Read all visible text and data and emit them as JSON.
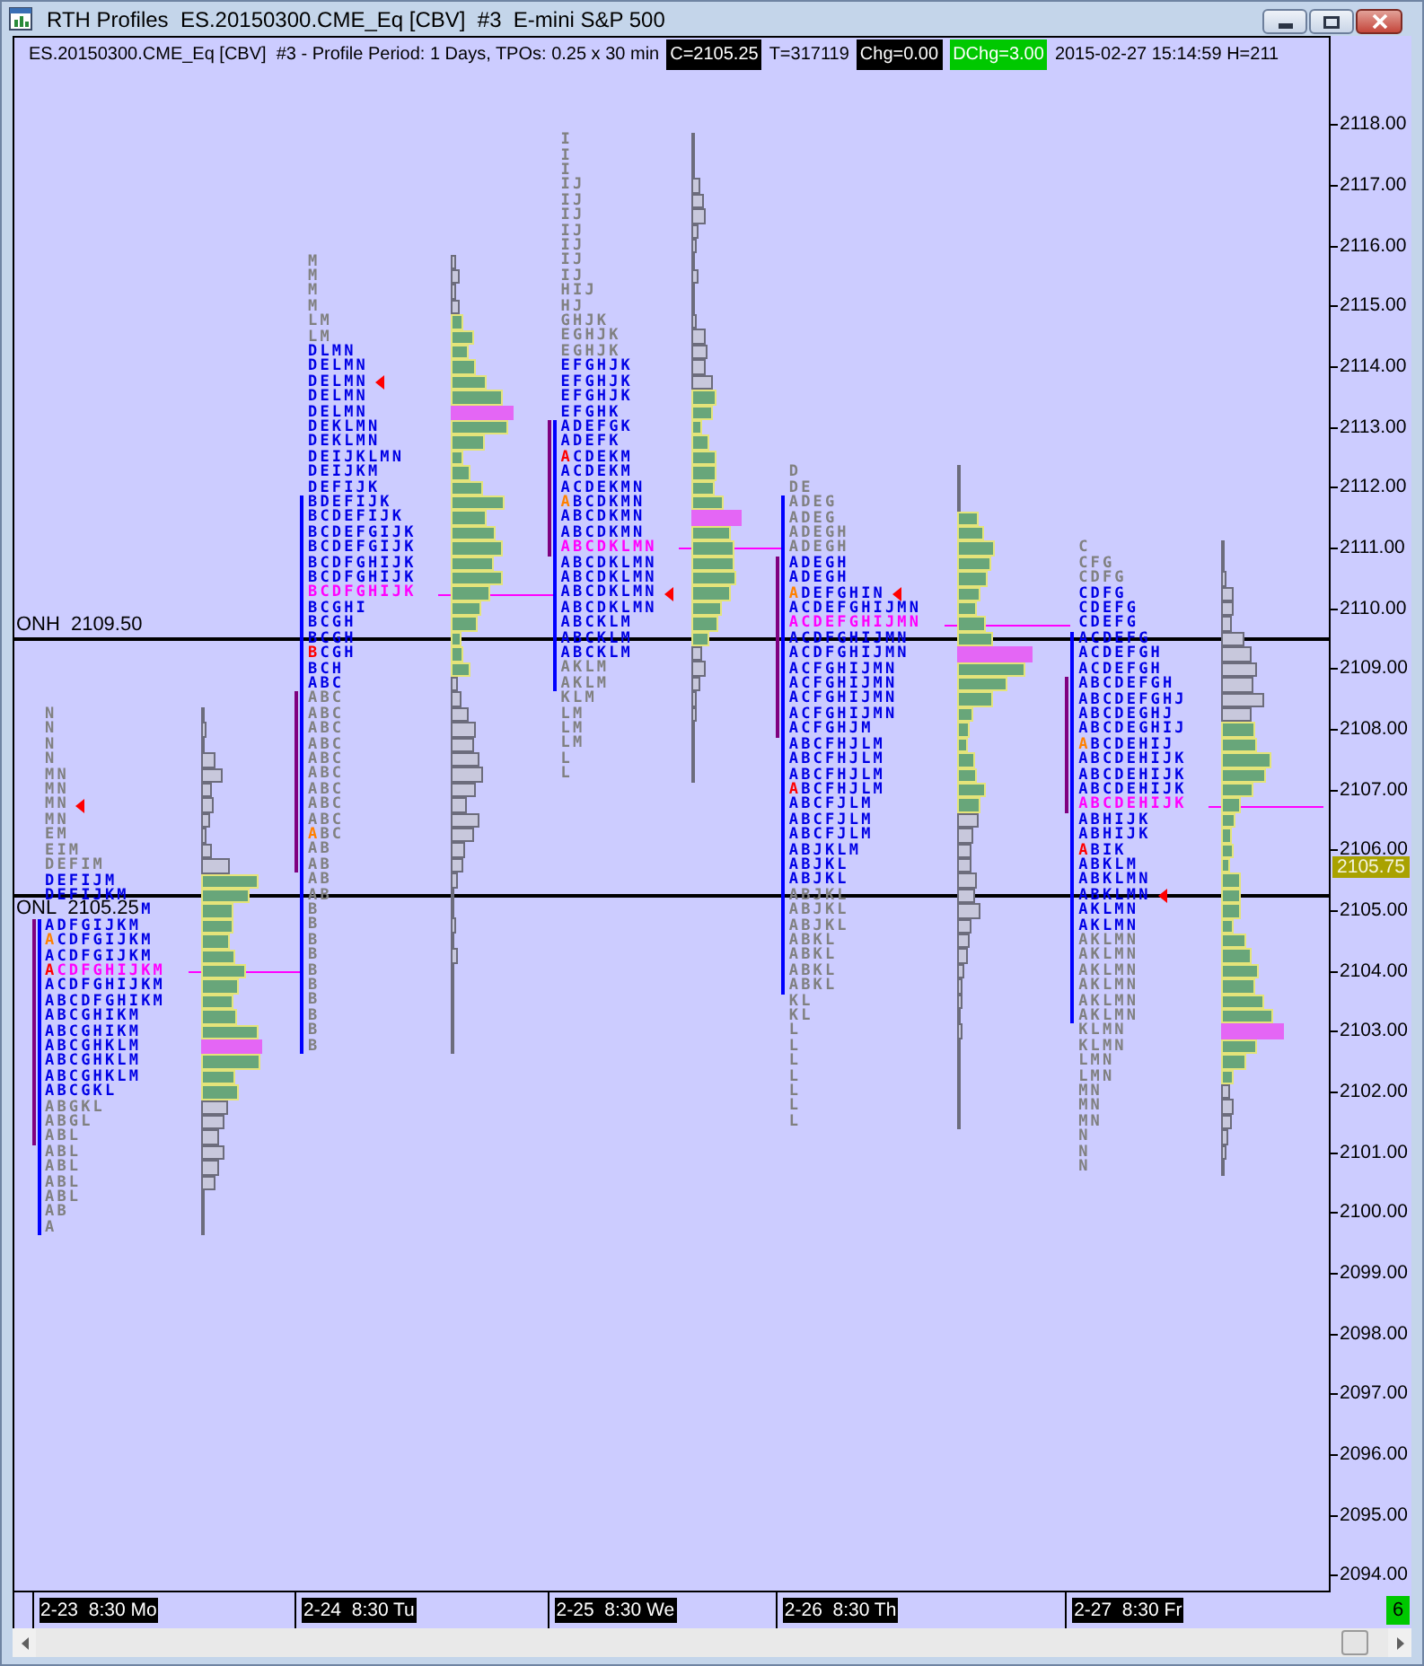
{
  "window": {
    "title": "RTH Profiles  ES.20150300.CME_Eq [CBV]  #3  E-mini S&P 500"
  },
  "header": [
    {
      "kind": "plain",
      "text": "ES.20150300.CME_Eq [CBV]  #3 - Profile Period: 1 Days, TPOs: 0.25 x 30 min"
    },
    {
      "kind": "dark",
      "text": "C=2105.25"
    },
    {
      "kind": "plain",
      "text": "T=317119"
    },
    {
      "kind": "dark",
      "text": "Chg=0.00"
    },
    {
      "kind": "green",
      "text": "DChg=3.00"
    },
    {
      "kind": "plain",
      "text": "2015-02-27 15:14:59 H=211"
    }
  ],
  "price_axis": {
    "ticks": [
      "2118.00",
      "2117.00",
      "2116.00",
      "2115.00",
      "2114.00",
      "2113.00",
      "2112.00",
      "2111.00",
      "2110.00",
      "2109.00",
      "2108.00",
      "2107.00",
      "2106.00",
      "2105.00",
      "2104.00",
      "2103.00",
      "2102.00",
      "2101.00",
      "2100.00",
      "2099.00",
      "2098.00",
      "2097.00",
      "2096.00",
      "2095.00",
      "2094.00"
    ],
    "last_price": "2105.75"
  },
  "levels": [
    {
      "kind": "high",
      "label": "ONH",
      "price": "2109.50"
    },
    {
      "kind": "low",
      "label": "ONL",
      "price": "2105.25"
    }
  ],
  "profiles": [
    {
      "date": "2-23  8:30 Mo",
      "rows": [
        {
          "letters": "N",
          "kind": "out",
          "bar": {
            "kind": "out"
          }
        },
        {
          "letters": "N",
          "kind": "out",
          "bar": {
            "kind": "out"
          }
        },
        {
          "letters": "N",
          "kind": "out",
          "bar": {
            "kind": "out"
          }
        },
        {
          "letters": "N",
          "kind": "out",
          "bar": {
            "kind": "out"
          }
        },
        {
          "letters": "MN",
          "kind": "out",
          "bar": {
            "kind": "out"
          }
        },
        {
          "letters": "MN",
          "kind": "out",
          "bar": {
            "kind": "out"
          }
        },
        {
          "letters": "MN",
          "kind": "out",
          "bar": {
            "kind": "out"
          },
          "marker": true
        },
        {
          "letters": "MN",
          "kind": "out",
          "bar": {
            "kind": "out"
          }
        },
        {
          "letters": "EM",
          "kind": "out",
          "bar": {
            "kind": "out"
          }
        },
        {
          "letters": "EIM",
          "kind": "out",
          "bar": {
            "kind": "out"
          }
        },
        {
          "letters": "DEFIM",
          "kind": "out",
          "bar": {
            "kind": "out"
          }
        },
        {
          "letters": "DEFIJM",
          "kind": "va",
          "bar": {
            "kind": "va"
          }
        },
        {
          "letters": "DEFIJKM",
          "kind": "va",
          "bar": {
            "kind": "va"
          }
        },
        {
          "letters": "M",
          "kind": "va",
          "bar": {
            "kind": "va"
          },
          "covered": true
        },
        {
          "letters": "ADFGIJKM",
          "kind": "va",
          "bar": {
            "kind": "va"
          },
          "ib": true,
          "band": true
        },
        {
          "letters": "ACDFGIJKM",
          "kind": "va",
          "bar": {
            "kind": "va"
          },
          "open_mark": true,
          "ib": true,
          "band": true
        },
        {
          "letters": "ACDFGIJKM",
          "kind": "va",
          "bar": {
            "kind": "va"
          },
          "ib": true,
          "band": true
        },
        {
          "letters": "ACDFGHIJKM",
          "kind": "poc",
          "bar": {
            "kind": "va"
          },
          "close_mark": true,
          "ib": true,
          "band": true
        },
        {
          "letters": "ACDFGHIJKM",
          "kind": "va",
          "bar": {
            "kind": "va"
          },
          "ib": true,
          "band": true
        },
        {
          "letters": "ABCDFGHIKM",
          "kind": "va",
          "bar": {
            "kind": "va"
          },
          "ib": true,
          "band": true
        },
        {
          "letters": "ABCGHIKM",
          "kind": "va",
          "bar": {
            "kind": "va"
          },
          "ib": true,
          "band": true
        },
        {
          "letters": "ABCGHIKM",
          "kind": "va",
          "bar": {
            "kind": "va"
          },
          "ib": true,
          "band": true
        },
        {
          "letters": "ABCGHKLM",
          "kind": "va",
          "bar": {
            "kind": "poc"
          },
          "ib": true,
          "band": true
        },
        {
          "letters": "ABCGHKLM",
          "kind": "va",
          "bar": {
            "kind": "va"
          },
          "ib": true,
          "band": true
        },
        {
          "letters": "ABCGHKLM",
          "kind": "va",
          "bar": {
            "kind": "va"
          },
          "ib": true,
          "band": true
        },
        {
          "letters": "ABCGKL",
          "kind": "va",
          "bar": {
            "kind": "va"
          },
          "ib": true,
          "band": true
        },
        {
          "letters": "ABGKL",
          "kind": "out",
          "bar": {
            "kind": "out"
          },
          "ib": true,
          "band": true
        },
        {
          "letters": "ABGL",
          "kind": "out",
          "bar": {
            "kind": "out"
          },
          "ib": true,
          "band": true
        },
        {
          "letters": "ABL",
          "kind": "out",
          "bar": {
            "kind": "out"
          },
          "ib": true,
          "band": true
        },
        {
          "letters": "ABL",
          "kind": "out",
          "bar": {
            "kind": "out"
          },
          "ib": true
        },
        {
          "letters": "ABL",
          "kind": "out",
          "bar": {
            "kind": "out"
          },
          "ib": true
        },
        {
          "letters": "ABL",
          "kind": "out",
          "bar": {
            "kind": "out"
          },
          "ib": true
        },
        {
          "letters": "ABL",
          "kind": "out",
          "bar": {
            "kind": "out"
          },
          "ib": true
        },
        {
          "letters": "AB",
          "kind": "out",
          "bar": {
            "kind": "out"
          },
          "ib": true
        },
        {
          "letters": "A",
          "kind": "out",
          "bar": {
            "kind": "out"
          },
          "ib": true
        }
      ]
    },
    {
      "date": "2-24  8:30 Tu",
      "rows": [
        {
          "letters": "M",
          "kind": "out",
          "bar": {
            "kind": "out"
          }
        },
        {
          "letters": "M",
          "kind": "out",
          "bar": {
            "kind": "out"
          }
        },
        {
          "letters": "M",
          "kind": "out",
          "bar": {
            "kind": "out"
          }
        },
        {
          "letters": "M",
          "kind": "out",
          "bar": {
            "kind": "out"
          }
        },
        {
          "letters": "LM",
          "kind": "out",
          "bar": {
            "kind": "va"
          }
        },
        {
          "letters": "LM",
          "kind": "out",
          "bar": {
            "kind": "va"
          }
        },
        {
          "letters": "DLMN",
          "kind": "va",
          "bar": {
            "kind": "va"
          }
        },
        {
          "letters": "DELMN",
          "kind": "va",
          "bar": {
            "kind": "va"
          }
        },
        {
          "letters": "DELMN",
          "kind": "va",
          "bar": {
            "kind": "va"
          },
          "marker": true
        },
        {
          "letters": "DELMN",
          "kind": "va",
          "bar": {
            "kind": "va"
          }
        },
        {
          "letters": "DELMN",
          "kind": "va",
          "bar": {
            "kind": "poc"
          }
        },
        {
          "letters": "DEKLMN",
          "kind": "va",
          "bar": {
            "kind": "va"
          }
        },
        {
          "letters": "DEKLMN",
          "kind": "va",
          "bar": {
            "kind": "va"
          }
        },
        {
          "letters": "DEIJKLMN",
          "kind": "va",
          "bar": {
            "kind": "va"
          }
        },
        {
          "letters": "DEIJKM",
          "kind": "va",
          "bar": {
            "kind": "va"
          }
        },
        {
          "letters": "DEFIJK",
          "kind": "va",
          "bar": {
            "kind": "va"
          }
        },
        {
          "letters": "BDEFIJK",
          "kind": "va",
          "bar": {
            "kind": "va"
          },
          "ib": true
        },
        {
          "letters": "BCDEFIJK",
          "kind": "va",
          "bar": {
            "kind": "va"
          },
          "ib": true
        },
        {
          "letters": "BCDEFGIJK",
          "kind": "va",
          "bar": {
            "kind": "va"
          },
          "ib": true
        },
        {
          "letters": "BCDEFGIJK",
          "kind": "va",
          "bar": {
            "kind": "va"
          },
          "ib": true
        },
        {
          "letters": "BCDFGHIJK",
          "kind": "va",
          "bar": {
            "kind": "va"
          },
          "ib": true
        },
        {
          "letters": "BCDFGHIJK",
          "kind": "va",
          "bar": {
            "kind": "va"
          },
          "ib": true
        },
        {
          "letters": "BCDFGHIJK",
          "kind": "poc",
          "bar": {
            "kind": "va"
          },
          "ib": true
        },
        {
          "letters": "BCGHI",
          "kind": "va",
          "bar": {
            "kind": "va"
          },
          "ib": true
        },
        {
          "letters": "BCGH",
          "kind": "va",
          "bar": {
            "kind": "va"
          },
          "ib": true
        },
        {
          "letters": "BCGH",
          "kind": "va",
          "bar": {
            "kind": "va"
          },
          "ib": true
        },
        {
          "letters": "BCGH",
          "kind": "va",
          "bar": {
            "kind": "va"
          },
          "close_mark": true,
          "ib": true
        },
        {
          "letters": "BCH",
          "kind": "va",
          "bar": {
            "kind": "va"
          },
          "ib": true
        },
        {
          "letters": "ABC",
          "kind": "va",
          "bar": {
            "kind": "out"
          },
          "ib": true
        },
        {
          "letters": "ABC",
          "kind": "out",
          "bar": {
            "kind": "out"
          },
          "ib": true,
          "band": true
        },
        {
          "letters": "ABC",
          "kind": "out",
          "bar": {
            "kind": "out"
          },
          "ib": true,
          "band": true
        },
        {
          "letters": "ABC",
          "kind": "out",
          "bar": {
            "kind": "out"
          },
          "ib": true,
          "band": true
        },
        {
          "letters": "ABC",
          "kind": "out",
          "bar": {
            "kind": "out"
          },
          "ib": true,
          "band": true
        },
        {
          "letters": "ABC",
          "kind": "out",
          "bar": {
            "kind": "out"
          },
          "ib": true,
          "band": true
        },
        {
          "letters": "ABC",
          "kind": "out",
          "bar": {
            "kind": "out"
          },
          "ib": true,
          "band": true
        },
        {
          "letters": "ABC",
          "kind": "out",
          "bar": {
            "kind": "out"
          },
          "ib": true,
          "band": true
        },
        {
          "letters": "ABC",
          "kind": "out",
          "bar": {
            "kind": "out"
          },
          "ib": true,
          "band": true
        },
        {
          "letters": "ABC",
          "kind": "out",
          "bar": {
            "kind": "out"
          },
          "ib": true,
          "band": true
        },
        {
          "letters": "ABC",
          "kind": "out",
          "bar": {
            "kind": "out"
          },
          "open_mark": true,
          "ib": true,
          "band": true
        },
        {
          "letters": "AB",
          "kind": "out",
          "bar": {
            "kind": "out"
          },
          "ib": true,
          "band": true
        },
        {
          "letters": "AB",
          "kind": "out",
          "bar": {
            "kind": "out"
          },
          "ib": true,
          "band": true
        },
        {
          "letters": "AB",
          "kind": "out",
          "bar": {
            "kind": "out"
          },
          "ib": true
        },
        {
          "letters": "AB",
          "kind": "out",
          "bar": {
            "kind": "out"
          },
          "ib": true
        },
        {
          "letters": "B",
          "kind": "out",
          "bar": {
            "kind": "out"
          },
          "ib": true
        },
        {
          "letters": "B",
          "kind": "out",
          "bar": {
            "kind": "out"
          },
          "ib": true
        },
        {
          "letters": "B",
          "kind": "out",
          "bar": {
            "kind": "out"
          },
          "ib": true
        },
        {
          "letters": "B",
          "kind": "out",
          "bar": {
            "kind": "out"
          },
          "ib": true
        },
        {
          "letters": "B",
          "kind": "out",
          "bar": {
            "kind": "out"
          },
          "ib": true
        },
        {
          "letters": "B",
          "kind": "out",
          "bar": {
            "kind": "out"
          },
          "ib": true
        },
        {
          "letters": "B",
          "kind": "out",
          "bar": {
            "kind": "out"
          },
          "ib": true
        },
        {
          "letters": "B",
          "kind": "out",
          "bar": {
            "kind": "out"
          },
          "ib": true
        },
        {
          "letters": "B",
          "kind": "out",
          "bar": {
            "kind": "out"
          },
          "ib": true
        },
        {
          "letters": "B",
          "kind": "out",
          "bar": {
            "kind": "out"
          },
          "ib": true
        }
      ]
    },
    {
      "date": "2-25  8:30 We",
      "rows": [
        {
          "letters": "I",
          "kind": "out",
          "bar": {
            "kind": "out"
          }
        },
        {
          "letters": "I",
          "kind": "out",
          "bar": {
            "kind": "out"
          }
        },
        {
          "letters": "I",
          "kind": "out",
          "bar": {
            "kind": "out"
          }
        },
        {
          "letters": "IJ",
          "kind": "out",
          "bar": {
            "kind": "out"
          }
        },
        {
          "letters": "IJ",
          "kind": "out",
          "bar": {
            "kind": "out"
          }
        },
        {
          "letters": "IJ",
          "kind": "out",
          "bar": {
            "kind": "out"
          }
        },
        {
          "letters": "IJ",
          "kind": "out",
          "bar": {
            "kind": "out"
          }
        },
        {
          "letters": "IJ",
          "kind": "out",
          "bar": {
            "kind": "out"
          }
        },
        {
          "letters": "IJ",
          "kind": "out",
          "bar": {
            "kind": "out"
          }
        },
        {
          "letters": "IJ",
          "kind": "out",
          "bar": {
            "kind": "out"
          }
        },
        {
          "letters": "HIJ",
          "kind": "out",
          "bar": {
            "kind": "out"
          }
        },
        {
          "letters": "HJ",
          "kind": "out",
          "bar": {
            "kind": "out"
          }
        },
        {
          "letters": "GHJK",
          "kind": "out",
          "bar": {
            "kind": "out"
          }
        },
        {
          "letters": "EGHJK",
          "kind": "out",
          "bar": {
            "kind": "out"
          }
        },
        {
          "letters": "EGHJK",
          "kind": "out",
          "bar": {
            "kind": "out"
          }
        },
        {
          "letters": "EFGHJK",
          "kind": "va",
          "bar": {
            "kind": "out"
          }
        },
        {
          "letters": "EFGHJK",
          "kind": "va",
          "bar": {
            "kind": "out"
          }
        },
        {
          "letters": "EFGHJK",
          "kind": "va",
          "bar": {
            "kind": "va"
          }
        },
        {
          "letters": "EFGHK",
          "kind": "va",
          "bar": {
            "kind": "va"
          }
        },
        {
          "letters": "ADEFGK",
          "kind": "va",
          "bar": {
            "kind": "va"
          },
          "ib": true,
          "band": true
        },
        {
          "letters": "ADEFK",
          "kind": "va",
          "bar": {
            "kind": "va"
          },
          "ib": true,
          "band": true
        },
        {
          "letters": "ACDEKM",
          "kind": "va",
          "bar": {
            "kind": "va"
          },
          "close_mark": true,
          "ib": true,
          "band": true
        },
        {
          "letters": "ACDEKM",
          "kind": "va",
          "bar": {
            "kind": "va"
          },
          "ib": true,
          "band": true
        },
        {
          "letters": "ACDEKMN",
          "kind": "va",
          "bar": {
            "kind": "va"
          },
          "ib": true,
          "band": true
        },
        {
          "letters": "ABCDKMN",
          "kind": "va",
          "bar": {
            "kind": "va"
          },
          "open_mark": true,
          "ib": true,
          "band": true
        },
        {
          "letters": "ABCDKMN",
          "kind": "va",
          "bar": {
            "kind": "poc"
          },
          "ib": true,
          "band": true
        },
        {
          "letters": "ABCDKMN",
          "kind": "va",
          "bar": {
            "kind": "va"
          },
          "ib": true,
          "band": true
        },
        {
          "letters": "ABCDKLMN",
          "kind": "poc",
          "bar": {
            "kind": "va"
          },
          "ib": true,
          "band": true
        },
        {
          "letters": "ABCDKLMN",
          "kind": "va",
          "bar": {
            "kind": "va"
          },
          "ib": true
        },
        {
          "letters": "ABCDKLMN",
          "kind": "va",
          "bar": {
            "kind": "va"
          },
          "ib": true
        },
        {
          "letters": "ABCDKLMN",
          "kind": "va",
          "bar": {
            "kind": "va"
          },
          "marker": true,
          "ib": true
        },
        {
          "letters": "ABCDKLMN",
          "kind": "va",
          "bar": {
            "kind": "va"
          },
          "ib": true
        },
        {
          "letters": "ABCKLM",
          "kind": "va",
          "bar": {
            "kind": "va"
          },
          "ib": true
        },
        {
          "letters": "ABCKLM",
          "kind": "va",
          "bar": {
            "kind": "va"
          },
          "ib": true
        },
        {
          "letters": "ABCKLM",
          "kind": "va",
          "bar": {
            "kind": "out"
          },
          "ib": true
        },
        {
          "letters": "AKLM",
          "kind": "out",
          "bar": {
            "kind": "out"
          },
          "ib": true
        },
        {
          "letters": "AKLM",
          "kind": "out",
          "bar": {
            "kind": "out"
          },
          "ib": true
        },
        {
          "letters": "KLM",
          "kind": "out",
          "bar": {
            "kind": "out"
          }
        },
        {
          "letters": "LM",
          "kind": "out",
          "bar": {
            "kind": "out"
          }
        },
        {
          "letters": "LM",
          "kind": "out",
          "bar": {
            "kind": "out"
          }
        },
        {
          "letters": "LM",
          "kind": "out",
          "bar": {
            "kind": "out"
          }
        },
        {
          "letters": "L",
          "kind": "out",
          "bar": {
            "kind": "out"
          }
        },
        {
          "letters": "L",
          "kind": "out",
          "bar": {
            "kind": "out"
          }
        }
      ]
    },
    {
      "date": "2-26  8:30 Th",
      "rows": [
        {
          "letters": "D",
          "kind": "out",
          "bar": {
            "kind": "out"
          }
        },
        {
          "letters": "DE",
          "kind": "out",
          "bar": {
            "kind": "out"
          }
        },
        {
          "letters": "ADEG",
          "kind": "out",
          "bar": {
            "kind": "out"
          },
          "ib": true
        },
        {
          "letters": "ADEG",
          "kind": "out",
          "bar": {
            "kind": "va"
          },
          "ib": true
        },
        {
          "letters": "ADEGH",
          "kind": "out",
          "bar": {
            "kind": "va"
          },
          "ib": true
        },
        {
          "letters": "ADEGH",
          "kind": "out",
          "bar": {
            "kind": "va"
          },
          "ib": true
        },
        {
          "letters": "ADEGH",
          "kind": "va",
          "bar": {
            "kind": "va"
          },
          "ib": true,
          "band": true
        },
        {
          "letters": "ADEGH",
          "kind": "va",
          "bar": {
            "kind": "va"
          },
          "ib": true,
          "band": true
        },
        {
          "letters": "ADEFGHIN",
          "kind": "va",
          "bar": {
            "kind": "va"
          },
          "open_mark": true,
          "marker": true,
          "ib": true,
          "band": true
        },
        {
          "letters": "ACDEFGHIJMN",
          "kind": "va",
          "bar": {
            "kind": "va"
          },
          "ib": true,
          "band": true
        },
        {
          "letters": "ACDEFGHIJMN",
          "kind": "poc",
          "bar": {
            "kind": "va"
          },
          "ib": true,
          "band": true
        },
        {
          "letters": "ACDFGHIJMN",
          "kind": "va",
          "bar": {
            "kind": "va"
          },
          "ib": true,
          "band": true
        },
        {
          "letters": "ACDFGHIJMN",
          "kind": "va",
          "bar": {
            "kind": "poc"
          },
          "ib": true,
          "band": true
        },
        {
          "letters": "ACFGHIJMN",
          "kind": "va",
          "bar": {
            "kind": "va"
          },
          "ib": true,
          "band": true
        },
        {
          "letters": "ACFGHIJMN",
          "kind": "va",
          "bar": {
            "kind": "va"
          },
          "ib": true,
          "band": true
        },
        {
          "letters": "ACFGHIJMN",
          "kind": "va",
          "bar": {
            "kind": "va"
          },
          "ib": true,
          "band": true
        },
        {
          "letters": "ACFGHIJMN",
          "kind": "va",
          "bar": {
            "kind": "va"
          },
          "ib": true,
          "band": true
        },
        {
          "letters": "ACFGHJM",
          "kind": "va",
          "bar": {
            "kind": "va"
          },
          "ib": true,
          "band": true
        },
        {
          "letters": "ABCFHJLM",
          "kind": "va",
          "bar": {
            "kind": "va"
          },
          "ib": true
        },
        {
          "letters": "ABCFHJLM",
          "kind": "va",
          "bar": {
            "kind": "va"
          },
          "ib": true
        },
        {
          "letters": "ABCFHJLM",
          "kind": "va",
          "bar": {
            "kind": "va"
          },
          "ib": true
        },
        {
          "letters": "ABCFHJLM",
          "kind": "va",
          "bar": {
            "kind": "va"
          },
          "close_mark": true,
          "ib": true
        },
        {
          "letters": "ABCFJLM",
          "kind": "va",
          "bar": {
            "kind": "va"
          },
          "ib": true
        },
        {
          "letters": "ABCFJLM",
          "kind": "va",
          "bar": {
            "kind": "out"
          },
          "ib": true
        },
        {
          "letters": "ABCFJLM",
          "kind": "va",
          "bar": {
            "kind": "out"
          },
          "ib": true
        },
        {
          "letters": "ABJKLM",
          "kind": "va",
          "bar": {
            "kind": "out"
          },
          "ib": true
        },
        {
          "letters": "ABJKL",
          "kind": "va",
          "bar": {
            "kind": "out"
          },
          "ib": true
        },
        {
          "letters": "ABJKL",
          "kind": "va",
          "bar": {
            "kind": "out"
          },
          "ib": true
        },
        {
          "letters": "ABJKL",
          "kind": "out",
          "bar": {
            "kind": "out"
          },
          "ib": true
        },
        {
          "letters": "ABJKL",
          "kind": "out",
          "bar": {
            "kind": "out"
          },
          "ib": true
        },
        {
          "letters": "ABJKL",
          "kind": "out",
          "bar": {
            "kind": "out"
          },
          "ib": true
        },
        {
          "letters": "ABKL",
          "kind": "out",
          "bar": {
            "kind": "out"
          },
          "ib": true
        },
        {
          "letters": "ABKL",
          "kind": "out",
          "bar": {
            "kind": "out"
          },
          "ib": true
        },
        {
          "letters": "ABKL",
          "kind": "out",
          "bar": {
            "kind": "out"
          },
          "ib": true
        },
        {
          "letters": "ABKL",
          "kind": "out",
          "bar": {
            "kind": "out"
          },
          "ib": true
        },
        {
          "letters": "KL",
          "kind": "out",
          "bar": {
            "kind": "out"
          }
        },
        {
          "letters": "KL",
          "kind": "out",
          "bar": {
            "kind": "out"
          }
        },
        {
          "letters": "L",
          "kind": "out",
          "bar": {
            "kind": "out"
          }
        },
        {
          "letters": "L",
          "kind": "out",
          "bar": {
            "kind": "out"
          }
        },
        {
          "letters": "L",
          "kind": "out",
          "bar": {
            "kind": "out"
          }
        },
        {
          "letters": "L",
          "kind": "out",
          "bar": {
            "kind": "out"
          }
        },
        {
          "letters": "L",
          "kind": "out",
          "bar": {
            "kind": "out"
          }
        },
        {
          "letters": "L",
          "kind": "out",
          "bar": {
            "kind": "out"
          }
        },
        {
          "letters": "L",
          "kind": "out",
          "bar": {
            "kind": "out"
          }
        }
      ]
    },
    {
      "date": "2-27  8:30 Fr",
      "rows": [
        {
          "letters": "C",
          "kind": "out",
          "bar": {
            "kind": "out"
          }
        },
        {
          "letters": "CFG",
          "kind": "out",
          "bar": {
            "kind": "out"
          }
        },
        {
          "letters": "CDFG",
          "kind": "out",
          "bar": {
            "kind": "out"
          }
        },
        {
          "letters": "CDFG",
          "kind": "va",
          "bar": {
            "kind": "out"
          }
        },
        {
          "letters": "CDEFG",
          "kind": "va",
          "bar": {
            "kind": "out"
          }
        },
        {
          "letters": "CDEFG",
          "kind": "va",
          "bar": {
            "kind": "out"
          }
        },
        {
          "letters": "ACDEFG",
          "kind": "va",
          "bar": {
            "kind": "out"
          },
          "ib": true
        },
        {
          "letters": "ACDEFGH",
          "kind": "va",
          "bar": {
            "kind": "out"
          },
          "ib": true
        },
        {
          "letters": "ACDEFGH",
          "kind": "va",
          "bar": {
            "kind": "out"
          },
          "ib": true
        },
        {
          "letters": "ABCDEFGH",
          "kind": "va",
          "bar": {
            "kind": "out"
          },
          "ib": true,
          "band": true
        },
        {
          "letters": "ABCDEFGHJ",
          "kind": "va",
          "bar": {
            "kind": "out"
          },
          "ib": true,
          "band": true
        },
        {
          "letters": "ABCDEGHJ",
          "kind": "va",
          "bar": {
            "kind": "out"
          },
          "ib": true,
          "band": true
        },
        {
          "letters": "ABCDEGHIJ",
          "kind": "va",
          "bar": {
            "kind": "va"
          },
          "ib": true,
          "band": true
        },
        {
          "letters": "ABCDEHIJ",
          "kind": "va",
          "bar": {
            "kind": "va"
          },
          "open_mark": true,
          "ib": true,
          "band": true
        },
        {
          "letters": "ABCDEHIJK",
          "kind": "va",
          "bar": {
            "kind": "va"
          },
          "ib": true,
          "band": true
        },
        {
          "letters": "ABCDEHIJK",
          "kind": "va",
          "bar": {
            "kind": "va"
          },
          "ib": true,
          "band": true
        },
        {
          "letters": "ABCDEHIJK",
          "kind": "va",
          "bar": {
            "kind": "va"
          },
          "ib": true,
          "band": true
        },
        {
          "letters": "ABCDEHIJK",
          "kind": "poc",
          "bar": {
            "kind": "va"
          },
          "ib": true,
          "band": true
        },
        {
          "letters": "ABHIJK",
          "kind": "va",
          "bar": {
            "kind": "va"
          },
          "ib": true
        },
        {
          "letters": "ABHIJK",
          "kind": "va",
          "bar": {
            "kind": "va"
          },
          "ib": true
        },
        {
          "letters": "ABIK",
          "kind": "va",
          "bar": {
            "kind": "va"
          },
          "close_mark": true,
          "ib": true
        },
        {
          "letters": "ABKLM",
          "kind": "va",
          "bar": {
            "kind": "va"
          },
          "ib": true
        },
        {
          "letters": "ABKLMN",
          "kind": "va",
          "bar": {
            "kind": "va"
          },
          "ib": true
        },
        {
          "letters": "ABKLMN",
          "kind": "va",
          "bar": {
            "kind": "va"
          },
          "marker": true,
          "ib": true
        },
        {
          "letters": "AKLMN",
          "kind": "va",
          "bar": {
            "kind": "va"
          },
          "ib": true
        },
        {
          "letters": "AKLMN",
          "kind": "va",
          "bar": {
            "kind": "va"
          },
          "ib": true
        },
        {
          "letters": "AKLMN",
          "kind": "out",
          "bar": {
            "kind": "va"
          },
          "ib": true
        },
        {
          "letters": "AKLMN",
          "kind": "out",
          "bar": {
            "kind": "va"
          },
          "ib": true
        },
        {
          "letters": "AKLMN",
          "kind": "out",
          "bar": {
            "kind": "va"
          },
          "ib": true
        },
        {
          "letters": "AKLMN",
          "kind": "out",
          "bar": {
            "kind": "va"
          },
          "ib": true
        },
        {
          "letters": "AKLMN",
          "kind": "out",
          "bar": {
            "kind": "va"
          },
          "ib": true
        },
        {
          "letters": "AKLMN",
          "kind": "out",
          "bar": {
            "kind": "va"
          },
          "ib": true
        },
        {
          "letters": "KLMN",
          "kind": "out",
          "bar": {
            "kind": "poc"
          }
        },
        {
          "letters": "KLMN",
          "kind": "out",
          "bar": {
            "kind": "va"
          }
        },
        {
          "letters": "LMN",
          "kind": "out",
          "bar": {
            "kind": "va"
          }
        },
        {
          "letters": "LMN",
          "kind": "out",
          "bar": {
            "kind": "va"
          }
        },
        {
          "letters": "MN",
          "kind": "out",
          "bar": {
            "kind": "out"
          }
        },
        {
          "letters": "MN",
          "kind": "out",
          "bar": {
            "kind": "out"
          }
        },
        {
          "letters": "MN",
          "kind": "out",
          "bar": {
            "kind": "out"
          }
        },
        {
          "letters": "N",
          "kind": "out",
          "bar": {
            "kind": "out"
          }
        },
        {
          "letters": "N",
          "kind": "out",
          "bar": {
            "kind": "out"
          }
        },
        {
          "letters": "N",
          "kind": "out",
          "bar": {
            "kind": "out"
          }
        }
      ]
    }
  ],
  "status_badge": "6"
}
